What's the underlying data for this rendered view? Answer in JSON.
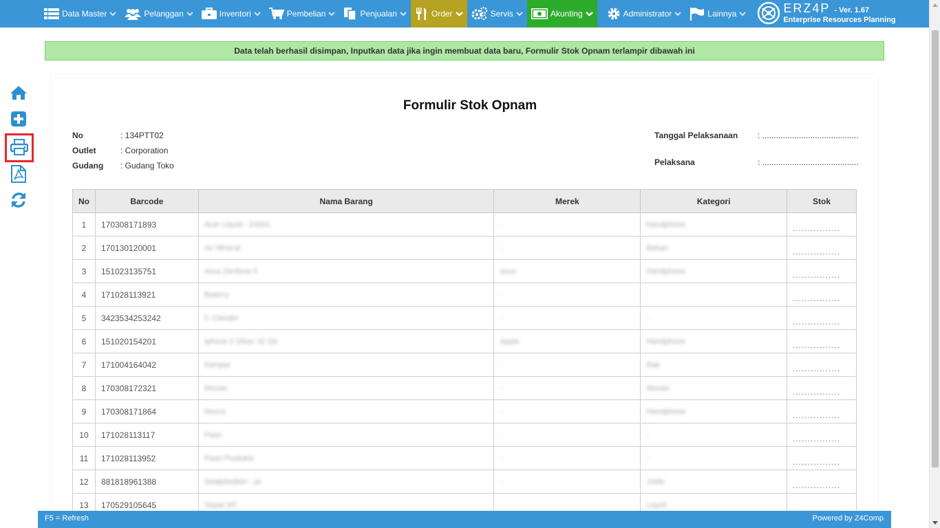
{
  "nav": {
    "items": [
      {
        "label": "Data Master",
        "icon": "table-list-icon"
      },
      {
        "label": "Pelanggan",
        "icon": "users-icon"
      },
      {
        "label": "Inventori",
        "icon": "briefcase-icon"
      },
      {
        "label": "Pembelian",
        "icon": "cart-icon"
      },
      {
        "label": "Penjualan",
        "icon": "documents-icon"
      },
      {
        "label": "Order",
        "icon": "utensils-icon"
      },
      {
        "label": "Servis",
        "icon": "gears-icon"
      },
      {
        "label": "Akunting",
        "icon": "money-icon"
      },
      {
        "label": "Administrator",
        "icon": "gear-icon"
      },
      {
        "label": "Lainnya",
        "icon": "flag-icon"
      }
    ],
    "active_colors": {
      "order": "#b5a321",
      "akunting": "#2dab2d"
    },
    "bar_color": "#3a96d6"
  },
  "brand": {
    "logo": "ERZ4P",
    "version": "- Ver. 1.67",
    "tagline": "Enterprise Resources Planning"
  },
  "alert": {
    "message": "Data telah berhasil disimpan, Inputkan data jika ingin membuat data baru, Formulir Stok Opnam terlampir dibawah ini"
  },
  "tools": [
    "home-icon",
    "add-icon",
    "print-icon",
    "pdf-icon",
    "refresh-icon"
  ],
  "doc": {
    "title": "Formulir Stok Opnam",
    "no_label": "No",
    "no_value": ": 134PTT02",
    "outlet_label": "Outlet",
    "outlet_value": ": Corporation",
    "gudang_label": "Gudang",
    "gudang_value": ": Gudang Toko",
    "tanggal_label": "Tanggal Pelaksanaan",
    "tanggal_value": ": ..........................................",
    "pelaksana_label": "Pelaksana",
    "pelaksana_value": ": .........................................."
  },
  "table": {
    "headers": [
      "No",
      "Barcode",
      "Nama Barang",
      "Merek",
      "Kategori",
      "Stok"
    ],
    "rows": [
      {
        "no": "1",
        "barcode": "170308171893",
        "nama": "Acer Liquid - Z4001",
        "merek": "-",
        "kategori": "Handphone",
        "stok": "................"
      },
      {
        "no": "2",
        "barcode": "170130120001",
        "nama": "Air Mineral",
        "merek": "-",
        "kategori": "Bahan",
        "stok": "................"
      },
      {
        "no": "3",
        "barcode": "151023135751",
        "nama": "Asus Zenfone 5",
        "merek": "asus",
        "kategori": "Handphone",
        "stok": "................"
      },
      {
        "no": "4",
        "barcode": "171028113921",
        "nama": "Baterry",
        "merek": "-",
        "kategori": "-",
        "stok": "................"
      },
      {
        "no": "5",
        "barcode": "3423534253242",
        "nama": "C Clander",
        "merek": "-",
        "kategori": "-",
        "stok": "................"
      },
      {
        "no": "6",
        "barcode": "151020154201",
        "nama": "Iphone 5 Silver 32 Gb",
        "merek": "Apple",
        "kategori": "Handphone",
        "stok": "................"
      },
      {
        "no": "7",
        "barcode": "171004164042",
        "nama": "Kemper",
        "merek": "-",
        "kategori": "Rak",
        "stok": "................"
      },
      {
        "no": "8",
        "barcode": "170308172321",
        "nama": "Mouse",
        "merek": "-",
        "kategori": "Mouse",
        "stok": "................"
      },
      {
        "no": "9",
        "barcode": "170308171864",
        "nama": "Nexus",
        "merek": "-",
        "kategori": "Handphone",
        "stok": "................"
      },
      {
        "no": "10",
        "barcode": "171028113117",
        "nama": "Paan",
        "merek": "-",
        "kategori": "-",
        "stok": "................"
      },
      {
        "no": "11",
        "barcode": "171028113952",
        "nama": "Paan Produksi",
        "merek": "-",
        "kategori": "-",
        "stok": "................"
      },
      {
        "no": "12",
        "barcode": "881818961388",
        "nama": "Sealjobstiker - pt",
        "merek": "-",
        "kategori": "Jotdo",
        "stok": "................"
      },
      {
        "no": "13",
        "barcode": "170529105645",
        "nama": "Sepat 3/5",
        "merek": "-",
        "kategori": "Liquid",
        "stok": "................"
      }
    ]
  },
  "footer": {
    "left": "F5 = Refresh",
    "right": "Powered by Z4Comp"
  }
}
